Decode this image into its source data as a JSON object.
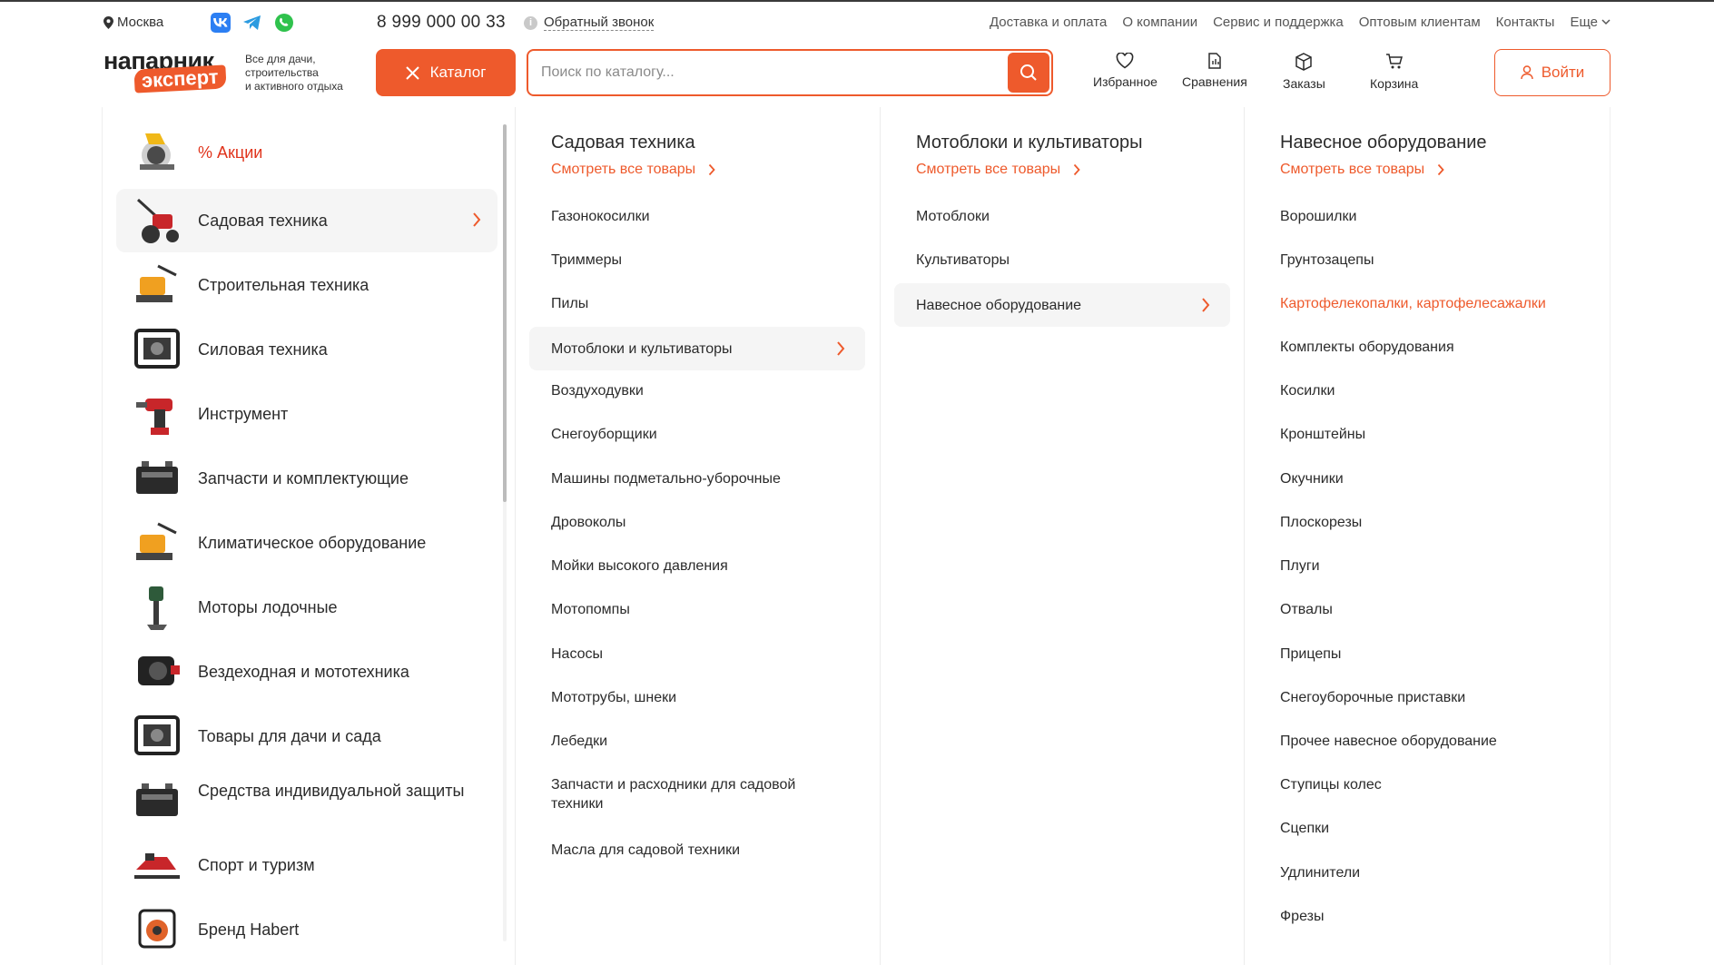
{
  "topbar": {
    "city": "Москва",
    "phone": "8 999 000 00 33",
    "callback": "Обратный звонок",
    "nav": [
      "Доставка и оплата",
      "О компании",
      "Сервис и поддержка",
      "Оптовым клиентам",
      "Контакты",
      "Еще"
    ]
  },
  "header": {
    "logo_top": "напарник",
    "logo_bottom": "эксперт",
    "slogan": [
      "Все для дачи,",
      "строительства",
      "и активного отдыха"
    ],
    "catalog_label": "Каталог",
    "search_placeholder": "Поиск по каталогу...",
    "icons": [
      {
        "label": "Избранное",
        "icon": "heart-icon"
      },
      {
        "label": "Сравнения",
        "icon": "compare-icon"
      },
      {
        "label": "Заказы",
        "icon": "box-icon"
      },
      {
        "label": "Корзина",
        "icon": "cart-icon"
      }
    ],
    "login_label": "Войти"
  },
  "colors": {
    "accent": "#ee5a2c",
    "promo": "#e0331b",
    "active_bg": "#f5f5f5"
  },
  "categories": [
    {
      "label": "% Акции"
    },
    {
      "label": "Садовая техника"
    },
    {
      "label": "Строительная техника"
    },
    {
      "label": "Силовая техника"
    },
    {
      "label": "Инструмент"
    },
    {
      "label": "Запчасти и комплектующие"
    },
    {
      "label": "Климатическое оборудование"
    },
    {
      "label": "Моторы лодочные"
    },
    {
      "label": "Вездеходная и мототехника"
    },
    {
      "label": "Товары для дачи и сада"
    },
    {
      "label": "Средства индивидуальной защиты"
    },
    {
      "label": "Спорт и туризм"
    },
    {
      "label": "Бренд Habert"
    }
  ],
  "col2": {
    "title": "Садовая техника",
    "see_all": "Смотреть все товары",
    "items": [
      "Газонокосилки",
      "Триммеры",
      "Пилы",
      "Мотоблоки и культиваторы",
      "Воздуходувки",
      "Снегоуборщики",
      "Машины подметально-уборочные",
      "Дровоколы",
      "Мойки высокого давления",
      "Мотопомпы",
      "Насосы",
      "Мототрубы, шнеки",
      "Лебедки",
      "Запчасти и расходники для садовой техники",
      "Масла для садовой техники"
    ]
  },
  "col3": {
    "title": "Мотоблоки и культиваторы",
    "see_all": "Смотреть все товары",
    "items": [
      "Мотоблоки",
      "Культиваторы",
      "Навесное оборудование"
    ]
  },
  "col4": {
    "title": "Навесное оборудование",
    "see_all": "Смотреть все товары",
    "items": [
      "Ворошилки",
      "Грунтозацепы",
      "Картофелекопалки, картофелесажалки",
      "Комплекты оборудования",
      "Косилки",
      "Кронштейны",
      "Окучники",
      "Плоскорезы",
      "Плуги",
      "Отвалы",
      "Прицепы",
      "Снегоуборочные приставки",
      "Прочее навесное оборудование",
      "Ступицы колес",
      "Сцепки",
      "Удлинители",
      "Фрезы"
    ]
  }
}
